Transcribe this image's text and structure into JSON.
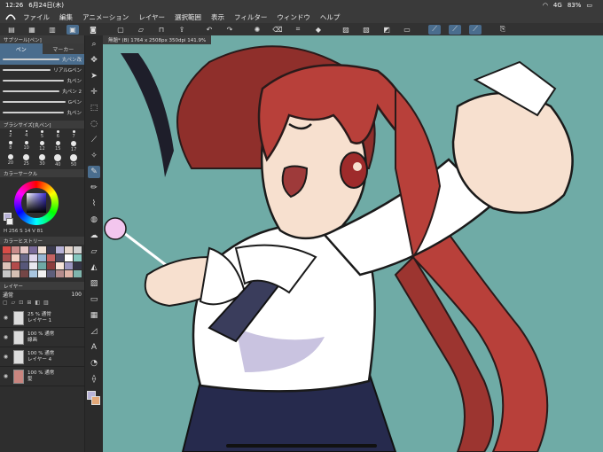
{
  "status": {
    "time": "12:26",
    "date": "6月24日(木)",
    "network": "4G",
    "battery": "83%"
  },
  "menu": [
    "ファイル",
    "編集",
    "アニメーション",
    "レイヤー",
    "選択範囲",
    "表示",
    "フィルター",
    "ウィンドウ",
    "ヘルプ"
  ],
  "subtool_panel": {
    "title": "サブツール[ペン]",
    "tabs": [
      "ペン",
      "マーカー"
    ],
    "brushes": [
      "丸ペン改",
      "リアルGペン",
      "丸ペン",
      "丸ペン 2",
      "Gペン",
      "丸ペン"
    ]
  },
  "brush_size_panel": {
    "title": "ブラシサイズ[丸ペン]",
    "sizes": [
      "2",
      "4",
      "5",
      "6",
      "7",
      "8",
      "10",
      "12",
      "15",
      "17",
      "20",
      "25",
      "30",
      "40",
      "50"
    ]
  },
  "color_circle": {
    "title": "カラーサークル",
    "hsv": [
      "H 256",
      "S 14",
      "V 81"
    ]
  },
  "color_history": {
    "title": "カラーヒストリー",
    "colors": [
      "#d94c47",
      "#c98b8a",
      "#e6c9c7",
      "#7a6a9a",
      "#f0e0d6",
      "#3b3b4f",
      "#b8b3d8",
      "#e7d6cc",
      "#d2d2d2",
      "#a85050",
      "#f3d2c6",
      "#6b6b8a",
      "#e1d7ee",
      "#99b7d4",
      "#c56363",
      "#4a4a63",
      "#ffffff",
      "#86c8c0",
      "#ddc3b8",
      "#b34b4b",
      "#575779",
      "#e8e8f0",
      "#6fa9a5",
      "#8c3d3d",
      "#f7e4d9",
      "#9b96c0",
      "#333344",
      "#c7c7c7",
      "#d4bfb3",
      "#744646",
      "#a9c6e0",
      "#f2f2f2",
      "#5e5e7a",
      "#b58c8c",
      "#e0b5a8",
      "#7fb5ad"
    ]
  },
  "layers_panel": {
    "title": "レイヤー",
    "blend": "通常",
    "opacity": "100",
    "layers": [
      {
        "opacity": "25 % 通常",
        "name": "レイヤー 1"
      },
      {
        "opacity": "100 % 通常",
        "name": "線画"
      },
      {
        "opacity": "100 % 通常",
        "name": "レイヤー 4"
      },
      {
        "opacity": "100 % 通常",
        "name": "髪"
      }
    ]
  },
  "document_tab": "無題* (B) 1764 x 2508px 350dpi 141.9%",
  "colors": {
    "canvas_bg": "#6faba6",
    "accent": "#4a6d8e",
    "hair": "#b8403a",
    "shirt": "#ffffff",
    "skirt": "#262a4d",
    "skin": "#f7e0cf"
  }
}
